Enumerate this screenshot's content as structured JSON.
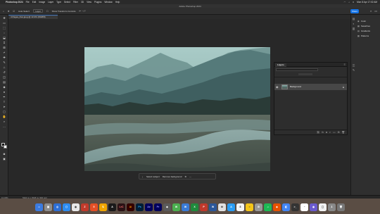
{
  "menubar": {
    "app_name": "Photoshop 2024",
    "items": [
      "File",
      "Edit",
      "Image",
      "Layer",
      "Type",
      "Select",
      "Filter",
      "3D",
      "View",
      "Plugins",
      "Window",
      "Help"
    ],
    "datetime": "Mon 8 Apr  17:02 AM"
  },
  "window": {
    "title": "Adobe Photoshop 2024"
  },
  "options": {
    "auto_select_label": "Auto-Select:",
    "auto_select_value": "Layer",
    "show_transform_label": "Show Transform Controls",
    "share_label": "Share"
  },
  "document": {
    "tab_label": "4 Pages_Doc.jpeg @ 13.3% (RGB/8)"
  },
  "contextual_taskbar": {
    "select_subject": "Select subject",
    "remove_background": "Remove background"
  },
  "layers_panel": {
    "title": "Layers",
    "layers": [
      {
        "name": "Background"
      }
    ]
  },
  "right_panel": {
    "items": [
      "Color",
      "Swatches",
      "Gradients",
      "Patterns"
    ]
  },
  "status": {
    "zoom": "13.33%",
    "doc_info": "5304 px x 3538 px (300 ppi)"
  },
  "colors": {
    "accent": "#1473e6",
    "app_bg": "#1e1e1e",
    "panel_bg": "#2f2f2f"
  }
}
